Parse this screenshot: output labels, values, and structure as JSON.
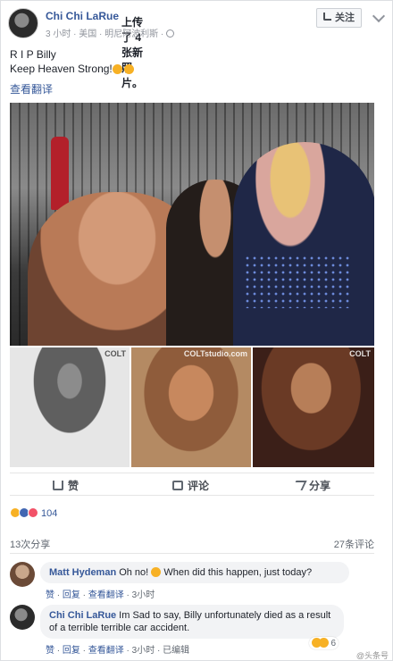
{
  "post": {
    "author": "Chi Chi LaRue",
    "action": "上传了 4 张新照片。",
    "meta": "3 小时 · 美国 · 明尼阿波利斯 ·",
    "follow_label": "关注",
    "text_line1": "R I P Billy",
    "text_line2": "Keep Heaven Strong!",
    "translate_label": "查看翻译"
  },
  "photos": {
    "watermark_1": "COLT",
    "watermark_2": "COLTstudio.com",
    "watermark_3": "COLT"
  },
  "actions": {
    "like": "赞",
    "comment": "评论",
    "share": "分享"
  },
  "stats": {
    "reactions_count": "104",
    "shares": "13次分享",
    "comments": "27条评论"
  },
  "comments": [
    {
      "author": "Matt Hydeman",
      "text_a": "Oh no!",
      "text_b": "When did this happen, just today?",
      "like": "赞",
      "reply": "回复",
      "translate": "查看翻译",
      "time": "3小时"
    },
    {
      "author": "Chi Chi LaRue",
      "text": "Im Sad to say, Billy unfortunately died as a result of a terrible terrible car accident.",
      "like": "赞",
      "reply": "回复",
      "translate": "查看翻译",
      "time": "3小时",
      "edited": "已编辑",
      "reaction_count": "6"
    }
  ],
  "watermark": "@头条号"
}
